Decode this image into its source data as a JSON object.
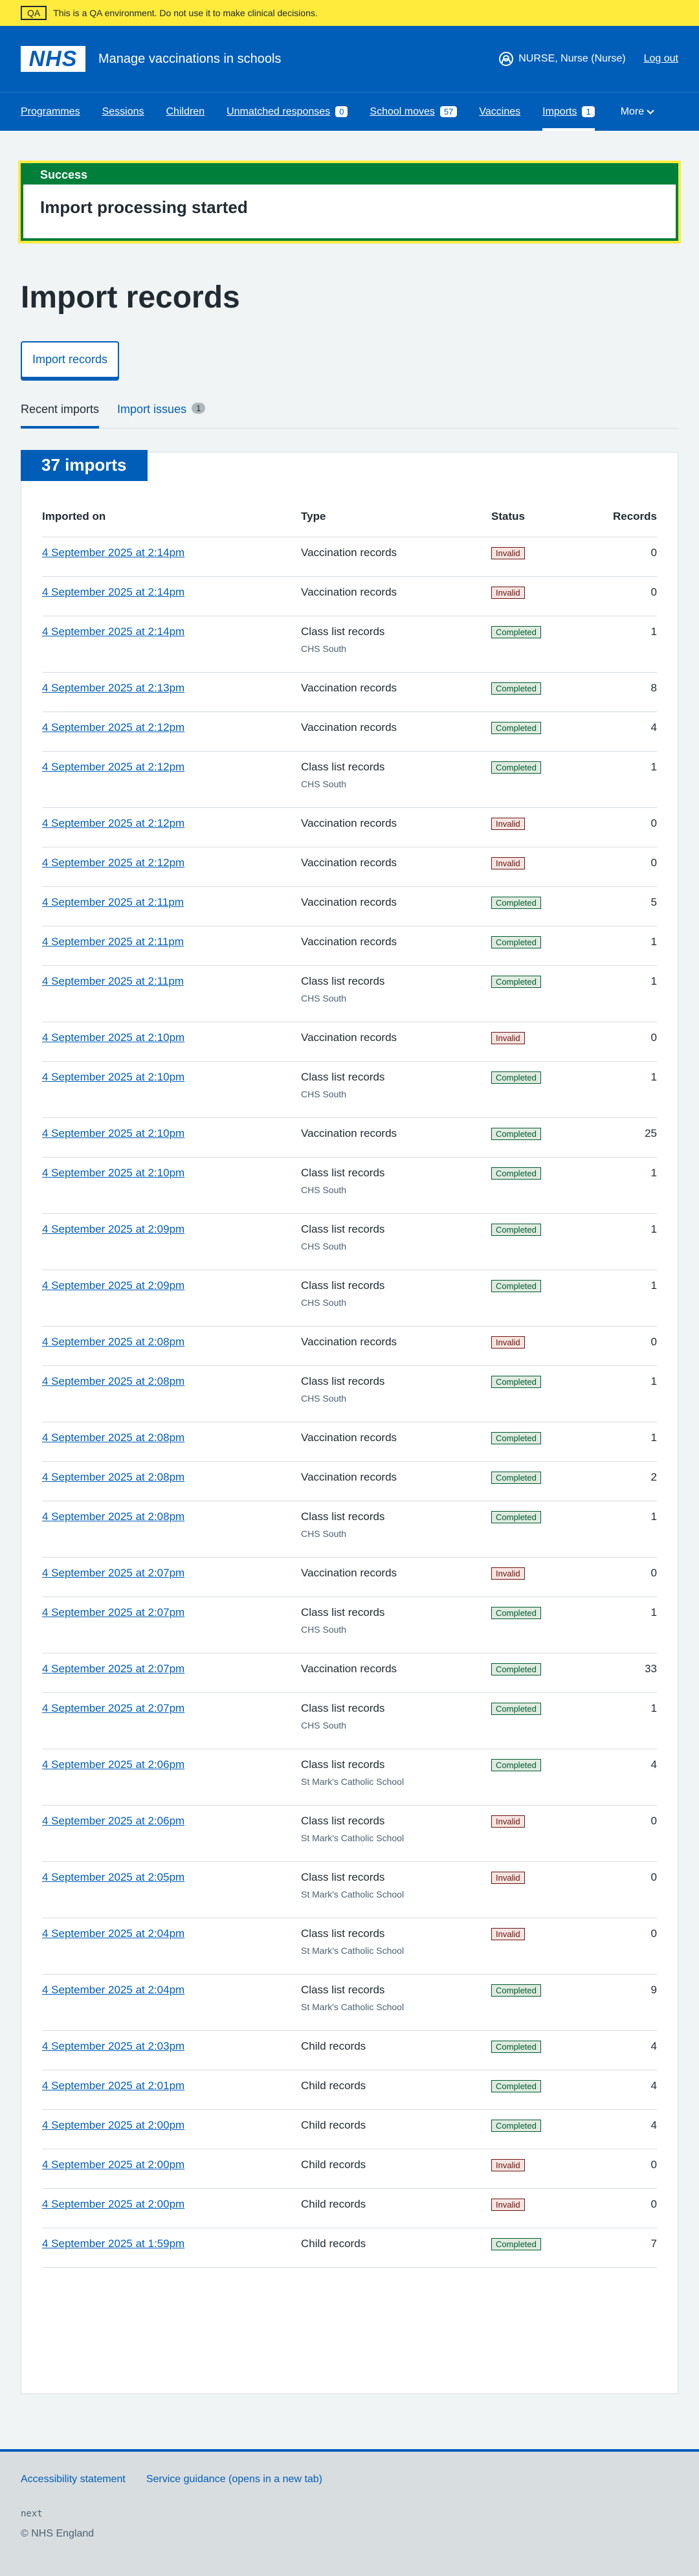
{
  "qa_banner": {
    "tag": "QA",
    "text": "This is a QA environment. Do not use it to make clinical decisions."
  },
  "header": {
    "logo": "NHS",
    "service_name": "Manage vaccinations in schools",
    "user": "NURSE, Nurse (Nurse)",
    "logout": "Log out"
  },
  "nav": {
    "items": [
      {
        "label": "Programmes",
        "count": null
      },
      {
        "label": "Sessions",
        "count": null
      },
      {
        "label": "Children",
        "count": null
      },
      {
        "label": "Unmatched responses",
        "count": "0"
      },
      {
        "label": "School moves",
        "count": "57"
      },
      {
        "label": "Vaccines",
        "count": null
      },
      {
        "label": "Imports",
        "count": "1"
      }
    ],
    "more": "More"
  },
  "success": {
    "title": "Success",
    "message": "Import processing started"
  },
  "page_title": "Import records",
  "import_button": "Import records",
  "tabs": {
    "recent": "Recent imports",
    "issues": "Import issues",
    "issues_count": "1"
  },
  "table": {
    "heading": "37 imports",
    "columns": {
      "imported_on": "Imported on",
      "type": "Type",
      "status": "Status",
      "records": "Records"
    },
    "rows": [
      {
        "date": "4 September 2025 at 2:14pm",
        "type": "Vaccination records",
        "sub": "",
        "status": "Invalid",
        "records": "0"
      },
      {
        "date": "4 September 2025 at 2:14pm",
        "type": "Vaccination records",
        "sub": "",
        "status": "Invalid",
        "records": "0"
      },
      {
        "date": "4 September 2025 at 2:14pm",
        "type": "Class list records",
        "sub": "CHS South",
        "status": "Completed",
        "records": "1"
      },
      {
        "date": "4 September 2025 at 2:13pm",
        "type": "Vaccination records",
        "sub": "",
        "status": "Completed",
        "records": "8"
      },
      {
        "date": "4 September 2025 at 2:12pm",
        "type": "Vaccination records",
        "sub": "",
        "status": "Completed",
        "records": "4"
      },
      {
        "date": "4 September 2025 at 2:12pm",
        "type": "Class list records",
        "sub": "CHS South",
        "status": "Completed",
        "records": "1"
      },
      {
        "date": "4 September 2025 at 2:12pm",
        "type": "Vaccination records",
        "sub": "",
        "status": "Invalid",
        "records": "0"
      },
      {
        "date": "4 September 2025 at 2:12pm",
        "type": "Vaccination records",
        "sub": "",
        "status": "Invalid",
        "records": "0"
      },
      {
        "date": "4 September 2025 at 2:11pm",
        "type": "Vaccination records",
        "sub": "",
        "status": "Completed",
        "records": "5"
      },
      {
        "date": "4 September 2025 at 2:11pm",
        "type": "Vaccination records",
        "sub": "",
        "status": "Completed",
        "records": "1"
      },
      {
        "date": "4 September 2025 at 2:11pm",
        "type": "Class list records",
        "sub": "CHS South",
        "status": "Completed",
        "records": "1"
      },
      {
        "date": "4 September 2025 at 2:10pm",
        "type": "Vaccination records",
        "sub": "",
        "status": "Invalid",
        "records": "0"
      },
      {
        "date": "4 September 2025 at 2:10pm",
        "type": "Class list records",
        "sub": "CHS South",
        "status": "Completed",
        "records": "1"
      },
      {
        "date": "4 September 2025 at 2:10pm",
        "type": "Vaccination records",
        "sub": "",
        "status": "Completed",
        "records": "25"
      },
      {
        "date": "4 September 2025 at 2:10pm",
        "type": "Class list records",
        "sub": "CHS South",
        "status": "Completed",
        "records": "1"
      },
      {
        "date": "4 September 2025 at 2:09pm",
        "type": "Class list records",
        "sub": "CHS South",
        "status": "Completed",
        "records": "1"
      },
      {
        "date": "4 September 2025 at 2:09pm",
        "type": "Class list records",
        "sub": "CHS South",
        "status": "Completed",
        "records": "1"
      },
      {
        "date": "4 September 2025 at 2:08pm",
        "type": "Vaccination records",
        "sub": "",
        "status": "Invalid",
        "records": "0"
      },
      {
        "date": "4 September 2025 at 2:08pm",
        "type": "Class list records",
        "sub": "CHS South",
        "status": "Completed",
        "records": "1"
      },
      {
        "date": "4 September 2025 at 2:08pm",
        "type": "Vaccination records",
        "sub": "",
        "status": "Completed",
        "records": "1"
      },
      {
        "date": "4 September 2025 at 2:08pm",
        "type": "Vaccination records",
        "sub": "",
        "status": "Completed",
        "records": "2"
      },
      {
        "date": "4 September 2025 at 2:08pm",
        "type": "Class list records",
        "sub": "CHS South",
        "status": "Completed",
        "records": "1"
      },
      {
        "date": "4 September 2025 at 2:07pm",
        "type": "Vaccination records",
        "sub": "",
        "status": "Invalid",
        "records": "0"
      },
      {
        "date": "4 September 2025 at 2:07pm",
        "type": "Class list records",
        "sub": "CHS South",
        "status": "Completed",
        "records": "1"
      },
      {
        "date": "4 September 2025 at 2:07pm",
        "type": "Vaccination records",
        "sub": "",
        "status": "Completed",
        "records": "33"
      },
      {
        "date": "4 September 2025 at 2:07pm",
        "type": "Class list records",
        "sub": "CHS South",
        "status": "Completed",
        "records": "1"
      },
      {
        "date": "4 September 2025 at 2:06pm",
        "type": "Class list records",
        "sub": "St Mark's Catholic School",
        "status": "Completed",
        "records": "4"
      },
      {
        "date": "4 September 2025 at 2:06pm",
        "type": "Class list records",
        "sub": "St Mark's Catholic School",
        "status": "Invalid",
        "records": "0"
      },
      {
        "date": "4 September 2025 at 2:05pm",
        "type": "Class list records",
        "sub": "St Mark's Catholic School",
        "status": "Invalid",
        "records": "0"
      },
      {
        "date": "4 September 2025 at 2:04pm",
        "type": "Class list records",
        "sub": "St Mark's Catholic School",
        "status": "Invalid",
        "records": "0"
      },
      {
        "date": "4 September 2025 at 2:04pm",
        "type": "Class list records",
        "sub": "St Mark's Catholic School",
        "status": "Completed",
        "records": "9"
      },
      {
        "date": "4 September 2025 at 2:03pm",
        "type": "Child records",
        "sub": "",
        "status": "Completed",
        "records": "4"
      },
      {
        "date": "4 September 2025 at 2:01pm",
        "type": "Child records",
        "sub": "",
        "status": "Completed",
        "records": "4"
      },
      {
        "date": "4 September 2025 at 2:00pm",
        "type": "Child records",
        "sub": "",
        "status": "Completed",
        "records": "4"
      },
      {
        "date": "4 September 2025 at 2:00pm",
        "type": "Child records",
        "sub": "",
        "status": "Invalid",
        "records": "0"
      },
      {
        "date": "4 September 2025 at 2:00pm",
        "type": "Child records",
        "sub": "",
        "status": "Invalid",
        "records": "0"
      },
      {
        "date": "4 September 2025 at 1:59pm",
        "type": "Child records",
        "sub": "",
        "status": "Completed",
        "records": "7"
      }
    ]
  },
  "footer": {
    "links": [
      "Accessibility statement",
      "Service guidance (opens in a new tab)"
    ],
    "next": "next",
    "copyright": "© NHS England"
  }
}
